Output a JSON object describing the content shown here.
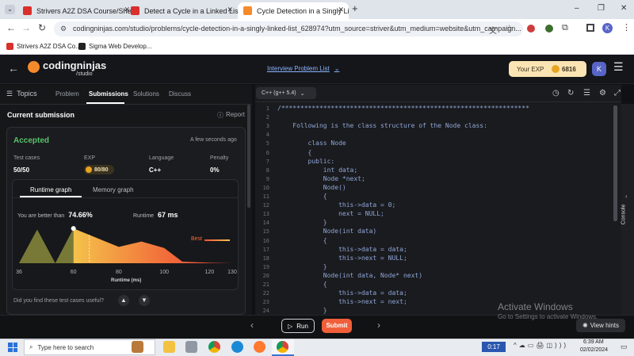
{
  "browser": {
    "tabs": [
      {
        "title": "Strivers A2Z DSA Course/Sheet",
        "active": false
      },
      {
        "title": "Detect a Cycle in a Linked List -",
        "active": false
      },
      {
        "title": "Cycle Detection in a Singly Linke",
        "active": true
      }
    ],
    "new_tab": "+",
    "window_controls": {
      "minimize": "–",
      "restore": "❐",
      "close": "✕"
    },
    "url": "codingninjas.com/studio/problems/cycle-detection-in-a-singly-linked-list_628974?utm_source=striver&utm_medium=website&utm_campaign...",
    "profile_initial": "K",
    "bookmarks": [
      "Strivers A2Z DSA Co...",
      "Sigma Web Develop..."
    ]
  },
  "site": {
    "logo_name": "codingninjas",
    "logo_sub": "/studio",
    "dropdown": "Interview Problem List",
    "exp_label": "Your EXP",
    "exp_value": "6816",
    "avatar": "K"
  },
  "left": {
    "topics": "Topics",
    "tabs": [
      "Problem",
      "Submissions",
      "Solutions",
      "Discuss"
    ],
    "active_tab": "Submissions",
    "section_title": "Current submission",
    "report": "Report",
    "status": "Accepted",
    "time": "A few seconds ago",
    "stats": [
      {
        "label": "Test cases",
        "value": "50/50"
      },
      {
        "label": "EXP",
        "value": "80/80"
      },
      {
        "label": "Language",
        "value": "C++"
      },
      {
        "label": "Penalty",
        "value": "0%"
      }
    ],
    "graph_tabs": [
      "Runtime graph",
      "Memory graph"
    ],
    "better_prefix": "You are better than",
    "better_value": "74.66%",
    "runtime_label": "Runtime",
    "runtime_value": "67 ms",
    "best_label": "Best",
    "x_ticks": [
      "36",
      "60",
      "80",
      "100",
      "120",
      "130"
    ],
    "x_title": "Runtime (ms)",
    "feedback": "Did you find these test cases useful?"
  },
  "chart_data": {
    "type": "area",
    "title": "",
    "xlabel": "Runtime (ms)",
    "ylabel": "",
    "xlim": [
      36,
      130
    ],
    "x": [
      36,
      44,
      52,
      60,
      80,
      90,
      100,
      108,
      120,
      130
    ],
    "y": [
      0,
      62,
      0,
      64,
      30,
      40,
      28,
      3,
      1,
      0
    ],
    "marker_x": 67,
    "colors": {
      "low": "#8a8b3c",
      "high": "#f0523a"
    }
  },
  "editor": {
    "language": "C++ (g++ 5.4)",
    "lines": [
      "/*****************************************************************",
      "",
      "    Following is the class structure of the Node class:",
      "",
      "        class Node",
      "        {",
      "        public:",
      "            int data;",
      "            Node *next;",
      "            Node()",
      "            {",
      "                this->data = 0;",
      "                next = NULL;",
      "            }",
      "            Node(int data)",
      "            {",
      "                this->data = data;",
      "                this->next = NULL;",
      "            }",
      "            Node(int data, Node* next)",
      "            {",
      "                this->data = data;",
      "                this->next = next;",
      "            }"
    ],
    "console": "Console"
  },
  "bottom": {
    "run": "Run",
    "submit": "Submit",
    "view_hints": "View hints",
    "watermark_title": "Activate Windows",
    "watermark_sub": "Go to Settings to activate Windows."
  },
  "taskbar": {
    "search_placeholder": "Type here to search",
    "timer": "0:17",
    "time": "6:39 AM",
    "date": "02/02/2024"
  }
}
